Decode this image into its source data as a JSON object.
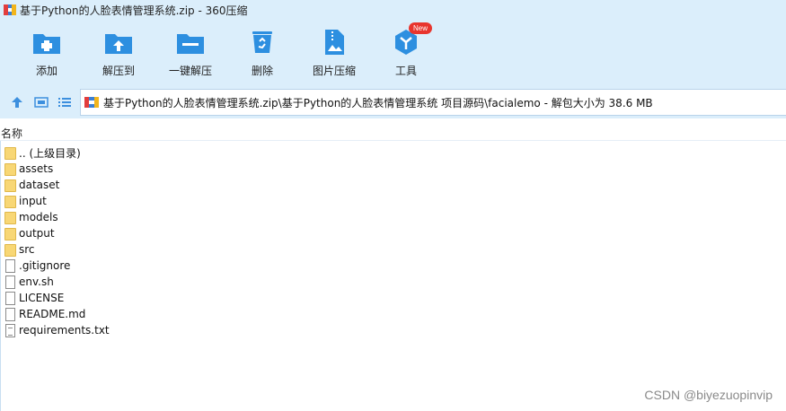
{
  "window": {
    "title": "基于Python的人脸表情管理系统.zip - 360压缩"
  },
  "toolbar": {
    "items": [
      {
        "label": "添加",
        "icon": "add-archive-icon"
      },
      {
        "label": "解压到",
        "icon": "extract-to-icon"
      },
      {
        "label": "一键解压",
        "icon": "one-click-extract-icon"
      },
      {
        "label": "删除",
        "icon": "recycle-bin-icon"
      },
      {
        "label": "图片压缩",
        "icon": "image-compress-icon"
      },
      {
        "label": "工具",
        "icon": "tools-icon",
        "badge": "New"
      }
    ]
  },
  "addressbar": {
    "path": "基于Python的人脸表情管理系统.zip\\基于Python的人脸表情管理系统 项目源码\\facialemo - 解包大小为 38.6 MB"
  },
  "filelist": {
    "column_name": "名称",
    "items": [
      {
        "name": ".. (上级目录)",
        "type": "folder"
      },
      {
        "name": "assets",
        "type": "folder"
      },
      {
        "name": "dataset",
        "type": "folder"
      },
      {
        "name": "input",
        "type": "folder"
      },
      {
        "name": "models",
        "type": "folder"
      },
      {
        "name": "output",
        "type": "folder"
      },
      {
        "name": "src",
        "type": "folder"
      },
      {
        "name": ".gitignore",
        "type": "file"
      },
      {
        "name": "env.sh",
        "type": "file"
      },
      {
        "name": "LICENSE",
        "type": "file"
      },
      {
        "name": "README.md",
        "type": "file"
      },
      {
        "name": "requirements.txt",
        "type": "text"
      }
    ]
  },
  "watermark": "CSDN @biyezuopinvip",
  "colors": {
    "toolbar_bg": "#dbeefb",
    "icon_blue": "#2d8fe0",
    "folder": "#f8d775",
    "badge_red": "#e8352e"
  }
}
